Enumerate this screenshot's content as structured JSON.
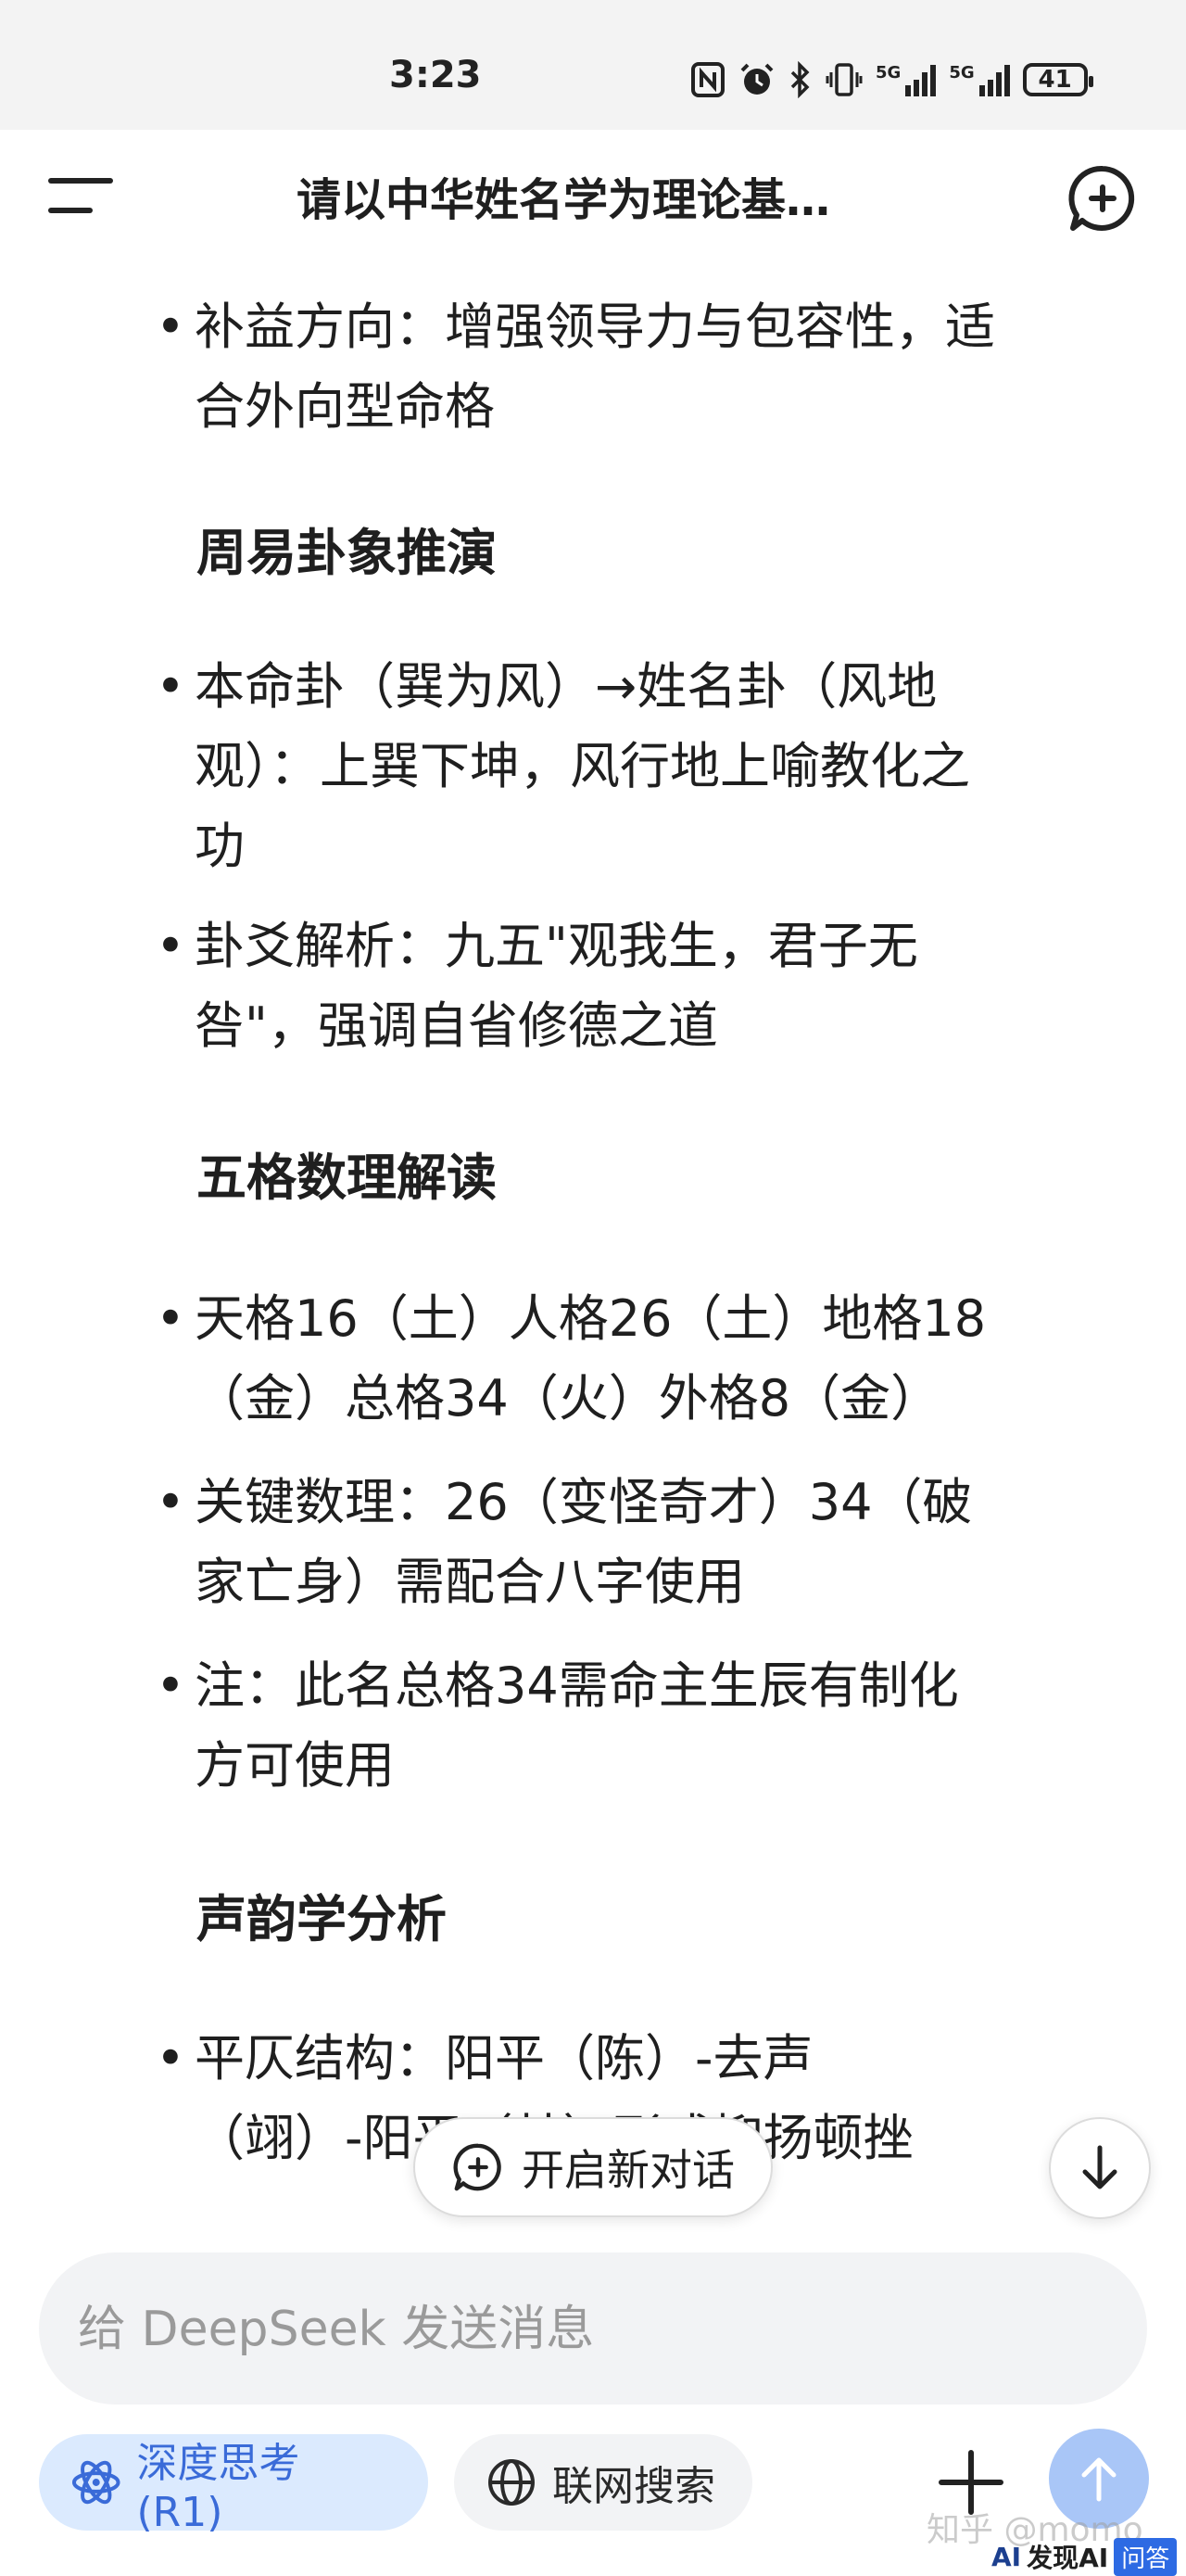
{
  "status_bar": {
    "time": "3:23",
    "network_label_1": "5G",
    "network_label_2": "5G",
    "battery": "41",
    "icons": [
      "nfc-icon",
      "alarm-icon",
      "bluetooth-icon",
      "vibrate-icon",
      "signal-icon",
      "signal-icon",
      "battery-icon"
    ]
  },
  "header": {
    "title": "请以中华姓名学为理论基…"
  },
  "content": {
    "bullet_1": [
      "补益方向：增强领导力与包容性，适",
      "合外向型命格"
    ],
    "heading_1": "周易卦象推演",
    "bullet_2": [
      "本命卦（巽为风）→姓名卦（风地",
      "观）：上巽下坤，风行地上喻教化之",
      "功"
    ],
    "bullet_3": [
      "卦爻解析：九五\"观我生，君子无",
      "咎\"，强调自省修德之道"
    ],
    "heading_2": "五格数理解读",
    "bullet_4": [
      "天格16（土）人格26（土）地格18",
      "（金）总格34（火）外格8（金）"
    ],
    "bullet_5": [
      "关键数理：26（变怪奇才）34（破",
      "家亡身）需配合八字使用"
    ],
    "bullet_6": [
      "注：此名总格34需命主生辰有制化",
      "方可使用"
    ],
    "heading_3": "声韵学分析",
    "bullet_7": [
      "平仄结构：阳平（陈）-去声",
      "（翊）-阳平（林）形成抑扬顿挫"
    ]
  },
  "floating": {
    "new_chat_label": "开启新对话"
  },
  "composer": {
    "placeholder": "给 DeepSeek 发送消息",
    "value": ""
  },
  "chips": {
    "deep_think": "深度思考 (R1)",
    "web_search": "联网搜索"
  },
  "colors": {
    "accent": "#3a6bd8",
    "chip_active_bg": "#dbeafe",
    "send_button": "#a9c6f7"
  },
  "watermark": {
    "text": "知乎 @momo",
    "badge_ai": "AI",
    "badge_name": "发现AI",
    "badge_qa": "问答"
  }
}
